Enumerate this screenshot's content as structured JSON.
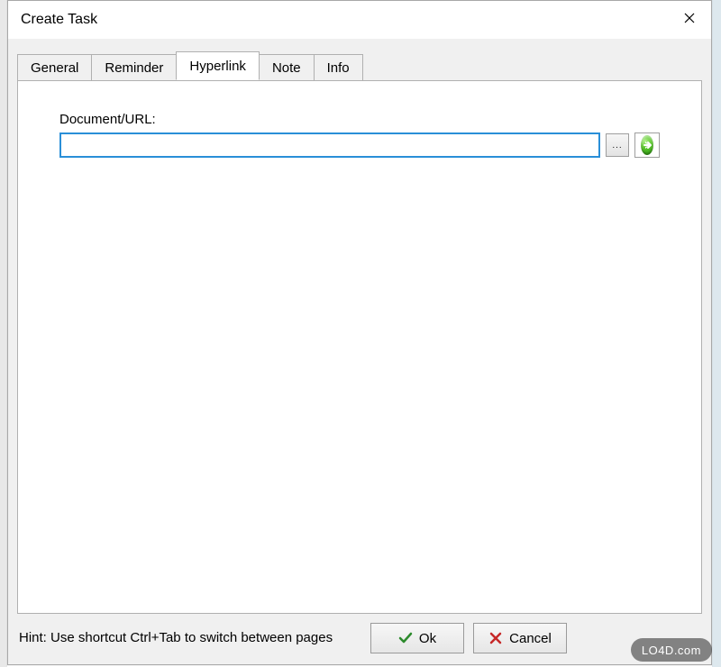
{
  "window": {
    "title": "Create Task"
  },
  "tabs": [
    {
      "label": "General",
      "active": false
    },
    {
      "label": "Reminder",
      "active": false
    },
    {
      "label": "Hyperlink",
      "active": true
    },
    {
      "label": "Note",
      "active": false
    },
    {
      "label": "Info",
      "active": false
    }
  ],
  "hyperlink_tab": {
    "field_label": "Document/URL:",
    "url_value": "",
    "browse_ellipsis": "..."
  },
  "footer": {
    "hint": "Hint: Use shortcut Ctrl+Tab to switch between pages",
    "ok_label": "Ok",
    "cancel_label": "Cancel"
  },
  "watermark": "LO4D.com"
}
